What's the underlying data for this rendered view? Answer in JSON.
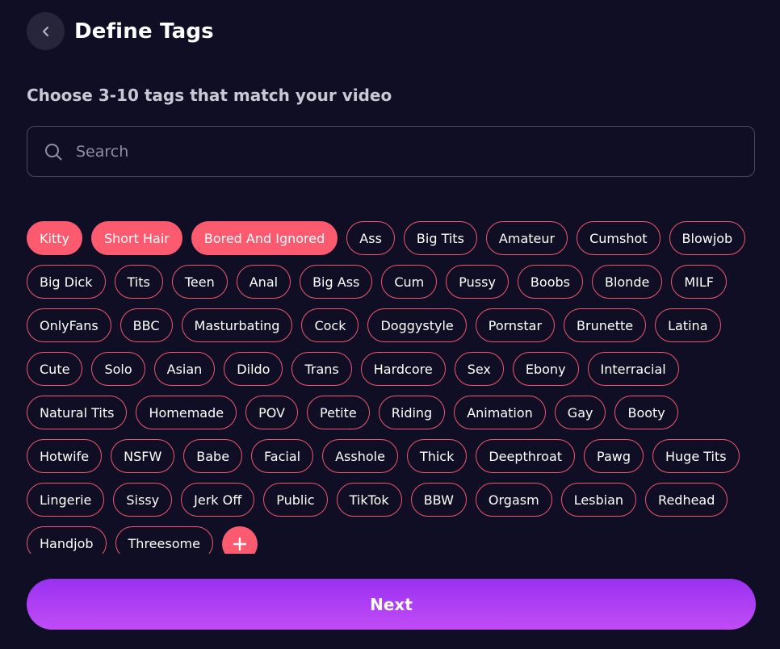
{
  "header": {
    "back_icon": "chevron-left-icon",
    "title": "Define Tags"
  },
  "subtitle": "Choose 3-10 tags that match your video",
  "search": {
    "placeholder": "Search",
    "value": "",
    "icon": "search-icon"
  },
  "colors": {
    "background": "#0f0e24",
    "accent": "#fb5a6f",
    "next_gradient_start": "#9a31f2",
    "next_gradient_end": "#c04cf6"
  },
  "tags": [
    {
      "label": "Kitty",
      "selected": true
    },
    {
      "label": "Short Hair",
      "selected": true
    },
    {
      "label": "Bored And Ignored",
      "selected": true
    },
    {
      "label": "Ass",
      "selected": false
    },
    {
      "label": "Big Tits",
      "selected": false
    },
    {
      "label": "Amateur",
      "selected": false
    },
    {
      "label": "Cumshot",
      "selected": false
    },
    {
      "label": "Blowjob",
      "selected": false
    },
    {
      "label": "Big Dick",
      "selected": false
    },
    {
      "label": "Tits",
      "selected": false
    },
    {
      "label": "Teen",
      "selected": false
    },
    {
      "label": "Anal",
      "selected": false
    },
    {
      "label": "Big Ass",
      "selected": false
    },
    {
      "label": "Cum",
      "selected": false
    },
    {
      "label": "Pussy",
      "selected": false
    },
    {
      "label": "Boobs",
      "selected": false
    },
    {
      "label": "Blonde",
      "selected": false
    },
    {
      "label": "MILF",
      "selected": false
    },
    {
      "label": "OnlyFans",
      "selected": false
    },
    {
      "label": "BBC",
      "selected": false
    },
    {
      "label": "Masturbating",
      "selected": false
    },
    {
      "label": "Cock",
      "selected": false
    },
    {
      "label": "Doggystyle",
      "selected": false
    },
    {
      "label": "Pornstar",
      "selected": false
    },
    {
      "label": "Brunette",
      "selected": false
    },
    {
      "label": "Latina",
      "selected": false
    },
    {
      "label": "Cute",
      "selected": false
    },
    {
      "label": "Solo",
      "selected": false
    },
    {
      "label": "Asian",
      "selected": false
    },
    {
      "label": "Dildo",
      "selected": false
    },
    {
      "label": "Trans",
      "selected": false
    },
    {
      "label": "Hardcore",
      "selected": false
    },
    {
      "label": "Sex",
      "selected": false
    },
    {
      "label": "Ebony",
      "selected": false
    },
    {
      "label": "Interracial",
      "selected": false
    },
    {
      "label": "Natural Tits",
      "selected": false
    },
    {
      "label": "Homemade",
      "selected": false
    },
    {
      "label": "POV",
      "selected": false
    },
    {
      "label": "Petite",
      "selected": false
    },
    {
      "label": "Riding",
      "selected": false
    },
    {
      "label": "Animation",
      "selected": false
    },
    {
      "label": "Gay",
      "selected": false
    },
    {
      "label": "Booty",
      "selected": false
    },
    {
      "label": "Hotwife",
      "selected": false
    },
    {
      "label": "NSFW",
      "selected": false
    },
    {
      "label": "Babe",
      "selected": false
    },
    {
      "label": "Facial",
      "selected": false
    },
    {
      "label": "Asshole",
      "selected": false
    },
    {
      "label": "Thick",
      "selected": false
    },
    {
      "label": "Deepthroat",
      "selected": false
    },
    {
      "label": "Pawg",
      "selected": false
    },
    {
      "label": "Huge Tits",
      "selected": false
    },
    {
      "label": "Lingerie",
      "selected": false
    },
    {
      "label": "Sissy",
      "selected": false
    },
    {
      "label": "Jerk Off",
      "selected": false
    },
    {
      "label": "Public",
      "selected": false
    },
    {
      "label": "TikTok",
      "selected": false
    },
    {
      "label": "BBW",
      "selected": false
    },
    {
      "label": "Orgasm",
      "selected": false
    },
    {
      "label": "Lesbian",
      "selected": false
    },
    {
      "label": "Redhead",
      "selected": false
    },
    {
      "label": "Handjob",
      "selected": false
    },
    {
      "label": "Threesome",
      "selected": false
    }
  ],
  "add_tag_icon": "plus-icon",
  "next_label": "Next"
}
